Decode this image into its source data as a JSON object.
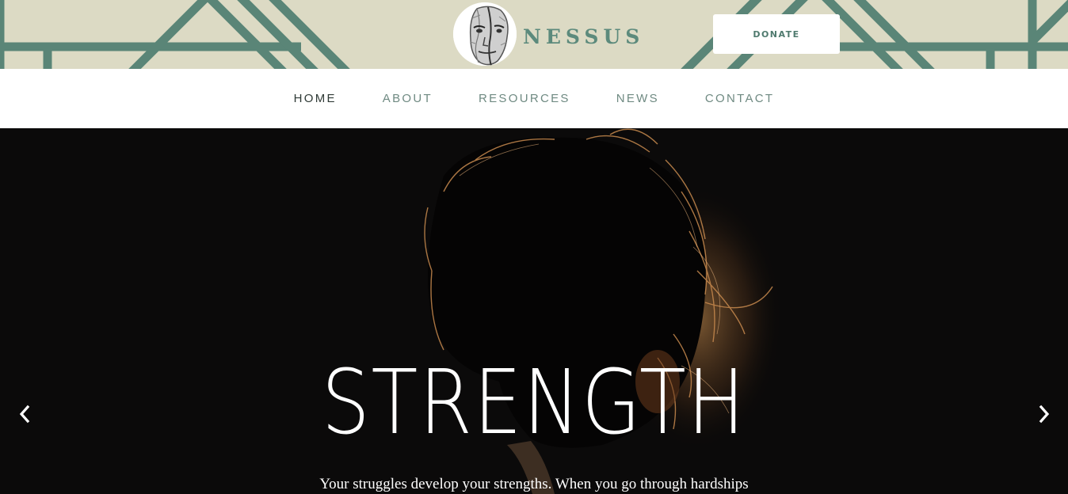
{
  "brand": {
    "name": "NESSUS",
    "accent_color": "#5c8a7c",
    "banner_color": "#dcdac4"
  },
  "header": {
    "donate_label": "DONATE"
  },
  "nav": {
    "items": [
      {
        "label": "HOME",
        "active": true
      },
      {
        "label": "ABOUT",
        "active": false
      },
      {
        "label": "RESOURCES",
        "active": false
      },
      {
        "label": "NEWS",
        "active": false
      },
      {
        "label": "CONTACT",
        "active": false
      }
    ]
  },
  "hero": {
    "title": "STRENGTH",
    "subtitle": "Your struggles develop your strengths. When you go through hardships",
    "prev_icon": "chevron-left-icon",
    "next_icon": "chevron-right-icon"
  }
}
